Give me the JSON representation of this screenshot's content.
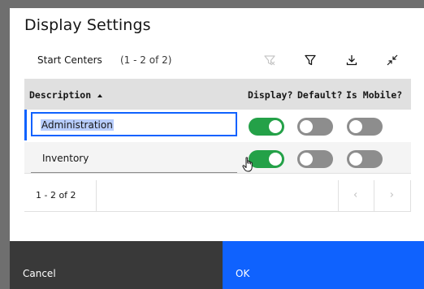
{
  "dialog": {
    "title": "Display Settings"
  },
  "toolbar": {
    "title": "Start Centers",
    "count": "(1 - 2 of 2)",
    "icons": [
      "clear-filter-icon",
      "filter-icon",
      "download-icon",
      "collapse-icon"
    ]
  },
  "table": {
    "columns": {
      "description": "Description",
      "display": "Display?",
      "default": "Default?",
      "mobile": "Is Mobile?"
    },
    "rows": [
      {
        "description": "Administration",
        "display": true,
        "default": false,
        "mobile": false,
        "selected": true
      },
      {
        "description": "Inventory",
        "display": true,
        "default": false,
        "mobile": false,
        "selected": false
      }
    ]
  },
  "pagination": {
    "range": "1 - 2 of 2"
  },
  "footer": {
    "cancel_label": "Cancel",
    "ok_label": "OK"
  },
  "colors": {
    "toggle_on": "#24a148",
    "toggle_off": "#8d8d8d",
    "primary": "#0f62fe",
    "secondary": "#393939"
  }
}
